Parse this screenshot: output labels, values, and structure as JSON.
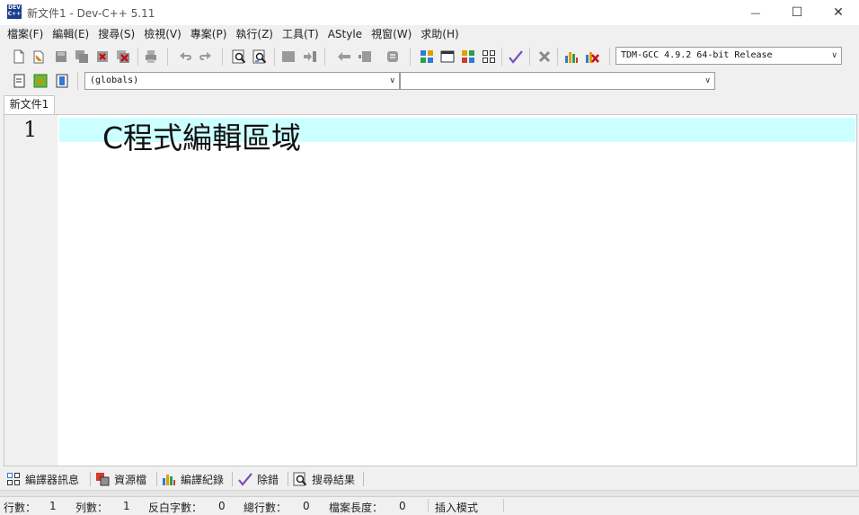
{
  "window": {
    "title": "新文件1 - Dev-C++ 5.11",
    "icon_label": "DEV C++",
    "minimize_glyph": "—",
    "maximize_glyph": "☐",
    "close_glyph": "✕"
  },
  "menu": [
    "檔案(F)",
    "編輯(E)",
    "搜尋(S)",
    "檢視(V)",
    "專案(P)",
    "執行(Z)",
    "工具(T)",
    "AStyle",
    "視窗(W)",
    "求助(H)"
  ],
  "toolbar": {
    "compiler_select": "TDM-GCC 4.9.2 64-bit Release",
    "scope_select": "(globals)",
    "symbol_select": "",
    "dropdown_glyph": "∨"
  },
  "editor": {
    "tab_label": "新文件1",
    "line_number": "1",
    "code_line": "C程式編輯區域"
  },
  "bottom_tabs": [
    "編譯器訊息",
    "資源檔",
    "編譯紀錄",
    "除錯",
    "搜尋結果"
  ],
  "status": {
    "line_label": "行數：",
    "line_value": "1",
    "col_label": "列數：",
    "col_value": "1",
    "selected_label": "反白字數：",
    "selected_value": "0",
    "total_lines_label": "總行數：",
    "total_lines_value": "0",
    "file_length_label": "檔案長度：",
    "file_length_value": "0",
    "mode": "插入模式"
  },
  "colors": {
    "active_line": "#ccffff",
    "chrome": "#f0f0f0",
    "accent": "#1a3f8f"
  }
}
